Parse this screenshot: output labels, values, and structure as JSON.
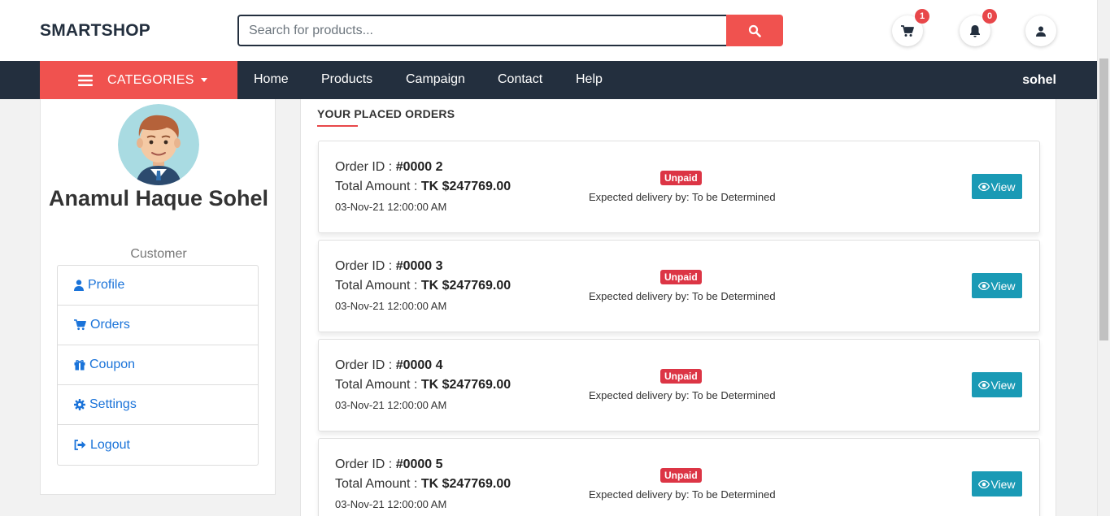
{
  "header": {
    "brand": "SMARTSHOP",
    "search_placeholder": "Search for products...",
    "cart_count": "1",
    "notification_count": "0"
  },
  "nav": {
    "categories_label": "CATEGORIES",
    "links": [
      "Home",
      "Products",
      "Campaign",
      "Contact",
      "Help"
    ],
    "username": "sohel"
  },
  "profile": {
    "name": "Anamul Haque Sohel",
    "role": "Customer",
    "menu": [
      "Profile",
      "Orders",
      "Coupon",
      "Settings",
      "Logout"
    ]
  },
  "orders": {
    "title": "YOUR PLACED ORDERS",
    "id_label": "Order ID : ",
    "amount_label": "Total Amount : ",
    "view_label": "View",
    "items": [
      {
        "id": "#0000 2",
        "amount": "TK $247769.00",
        "date": "03-Nov-21 12:00:00 AM",
        "status": "Unpaid",
        "delivery": "Expected delivery by: To be Determined"
      },
      {
        "id": "#0000 3",
        "amount": "TK $247769.00",
        "date": "03-Nov-21 12:00:00 AM",
        "status": "Unpaid",
        "delivery": "Expected delivery by: To be Determined"
      },
      {
        "id": "#0000 4",
        "amount": "TK $247769.00",
        "date": "03-Nov-21 12:00:00 AM",
        "status": "Unpaid",
        "delivery": "Expected delivery by: To be Determined"
      },
      {
        "id": "#0000 5",
        "amount": "TK $247769.00",
        "date": "03-Nov-21 12:00:00 AM",
        "status": "Unpaid",
        "delivery": "Expected delivery by: To be Determined"
      }
    ]
  },
  "colors": {
    "accent": "#f0524f",
    "navy": "#232f3e",
    "link": "#1a73d9",
    "view_button": "#1a9ab5",
    "unpaid": "#dc3545"
  }
}
